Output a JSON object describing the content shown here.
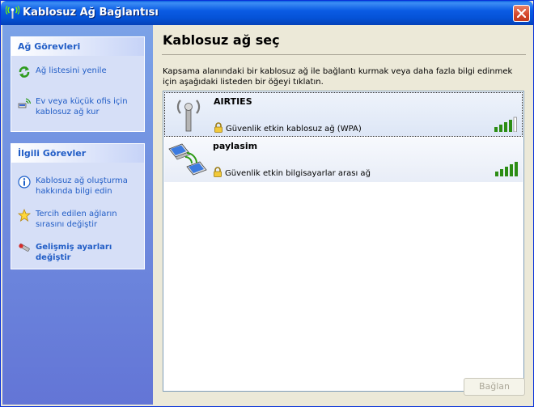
{
  "window": {
    "title": "Kablosuz Ağ Bağlantısı"
  },
  "tasks": {
    "network_tasks": {
      "header": "Ağ Görevleri",
      "items": [
        {
          "label": "Ağ listesini yenile",
          "icon": "refresh-icon"
        },
        {
          "label": "Ev veya küçük ofis için kablosuz ağ kur",
          "icon": "setup-network-icon"
        }
      ]
    },
    "related_tasks": {
      "header": "İlgili Görevler",
      "items": [
        {
          "label": "Kablosuz ağ oluşturma hakkında bilgi edin",
          "icon": "info-icon"
        },
        {
          "label": "Tercih edilen ağların sırasını değiştir",
          "icon": "star-icon"
        },
        {
          "label": "Gelişmiş ayarları değiştir",
          "icon": "settings-icon"
        }
      ]
    }
  },
  "main": {
    "title": "Kablosuz ağ seç",
    "instructions": "Kapsama alanındaki bir kablosuz ağ ile bağlantı kurmak veya daha fazla bilgi edinmek için aşağıdaki listeden bir öğeyi tıklatın.",
    "networks": [
      {
        "name": "AIRTIES",
        "security": "Güvenlik etkin kablosuz ağ (WPA)",
        "signal_bars": 4,
        "signal_max": 5,
        "icon": "access-point-icon"
      },
      {
        "name": "paylasim",
        "security": "Güvenlik etkin bilgisayarlar arası ağ",
        "signal_bars": 5,
        "signal_max": 5,
        "icon": "ad-hoc-network-icon"
      }
    ],
    "connect_label": "Bağlan"
  },
  "colors": {
    "title_bar": "#0553d7",
    "task_link": "#215dc6",
    "signal_green": "#2c8d14"
  }
}
